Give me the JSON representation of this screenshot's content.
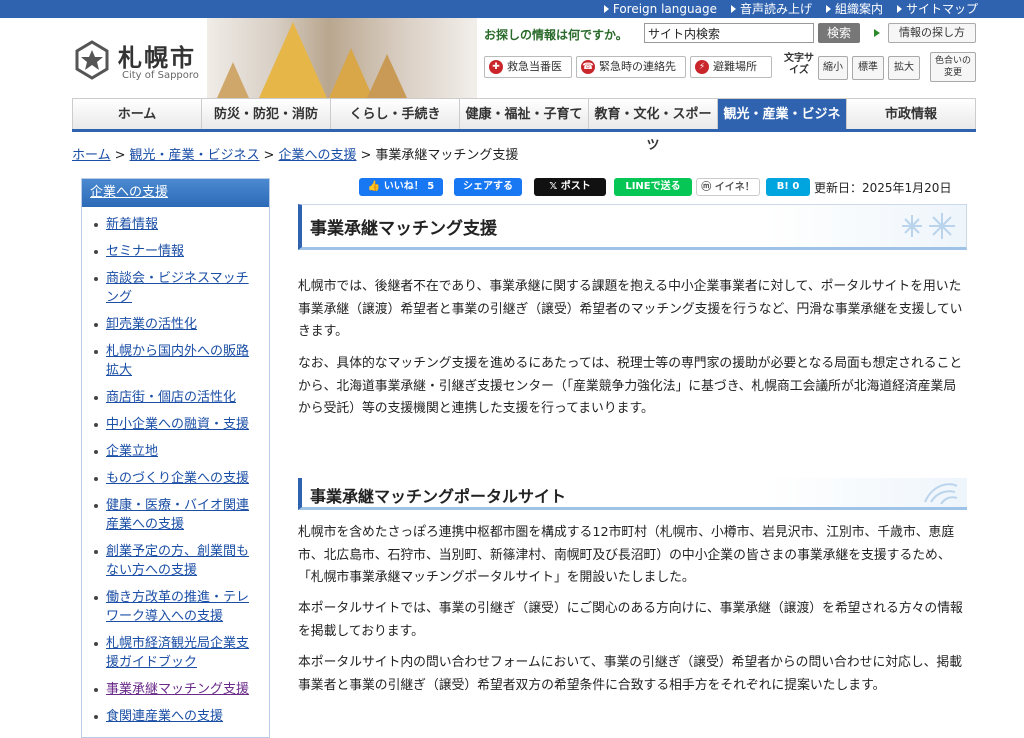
{
  "topbar": {
    "links": [
      "Foreign language",
      "音声読み上げ",
      "組織案内",
      "サイトマップ"
    ]
  },
  "header": {
    "logo_name": "札幌市",
    "logo_sub": "City of Sapporo",
    "search_label": "お探しの情報は何ですか。",
    "search_value": "サイト内検索",
    "search_button": "検索",
    "find_button": "情報の探し方",
    "emergency": [
      "救急当番医",
      "緊急時の連絡先",
      "避難場所"
    ],
    "text_size_label": "文字サイズ",
    "size_small": "縮小",
    "size_normal": "標準",
    "size_large": "拡大",
    "color_change": "色合いの変更"
  },
  "nav": {
    "items": [
      {
        "label": "ホーム",
        "active": false
      },
      {
        "label": "防災・防犯・消防",
        "active": false
      },
      {
        "label": "くらし・手続き",
        "active": false
      },
      {
        "label": "健康・福祉・子育て",
        "active": false
      },
      {
        "label": "教育・文化・スポーツ",
        "active": false
      },
      {
        "label": "観光・産業・ビジネス",
        "active": true
      },
      {
        "label": "市政情報",
        "active": false
      }
    ]
  },
  "breadcrumb": {
    "links": [
      "ホーム",
      "観光・産業・ビジネス",
      "企業への支援"
    ],
    "separator": ">",
    "current": "事業承継マッチング支援"
  },
  "sidebar": {
    "heading": "企業への支援",
    "items": [
      "新着情報",
      "セミナー情報",
      "商談会・ビジネスマッチング",
      "卸売業の活性化",
      "札幌から国内外への販路拡大",
      "商店街・個店の活性化",
      "中小企業への融資・支援",
      "企業立地",
      "ものづくり企業への支援",
      "健康・医療・バイオ関連産業への支援",
      "創業予定の方、創業間もない方への支援",
      "働き方改革の推進・テレワーク導入への支援",
      "札幌市経済観光局企業支援ガイドブック",
      "事業承継マッチング支援",
      "食関連産業への支援"
    ],
    "current_index": 13
  },
  "share": {
    "like": "いいね！ 5",
    "share": "シェアする",
    "post": "ポスト",
    "line": "LINEで送る",
    "mixi": "イイネ！",
    "hatena": "B! 0"
  },
  "updated": "更新日：2025年1月20日",
  "content": {
    "title": "事業承継マッチング支援",
    "p1": "札幌市では、後継者不在であり、事業承継に関する課題を抱える中小企業事業者に対して、ポータルサイトを用いた事業承継（譲渡）希望者と事業の引継ぎ（譲受）希望者のマッチング支援を行うなど、円滑な事業承継を支援していきます。",
    "p2": "なお、具体的なマッチング支援を進めるにあたっては、税理士等の専門家の援助が必要となる局面も想定されることから、北海道事業承継・引継ぎ支援センター（「産業競争力強化法」に基づき、札幌商工会議所が北海道経済産業局から受託）等の支援機関と連携した支援を行ってまいります。",
    "h2": "事業承継マッチングポータルサイト",
    "p3": "札幌市を含めたさっぽろ連携中枢都市圏を構成する12市町村（札幌市、小樽市、岩見沢市、江別市、千歳市、恵庭市、北広島市、石狩市、当別町、新篠津村、南幌町及び長沼町）の中小企業の皆さまの事業承継を支援するため、「札幌市事業承継マッチングポータルサイト」を開設いたしました。",
    "p4": "本ポータルサイトでは、事業の引継ぎ（譲受）にご関心のある方向けに、事業承継（譲渡）を希望される方々の情報を掲載しております。",
    "p5": "本ポータルサイト内の問い合わせフォームにおいて、事業の引継ぎ（譲受）希望者からの問い合わせに対応し、掲載事業者と事業の引継ぎ（譲受）希望者双方の希望条件に合致する相手方をそれぞれに提案いたします。"
  },
  "colors": {
    "brand_blue": "#2f63b0",
    "link_blue": "#1b4fa6",
    "emergency_red": "#c8262b"
  }
}
